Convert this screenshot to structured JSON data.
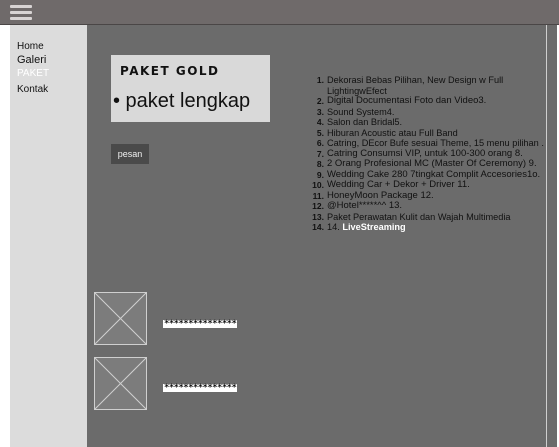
{
  "nav": {
    "items": [
      {
        "label": "Home"
      },
      {
        "label": "Galeri"
      },
      {
        "label": "PAKET"
      },
      {
        "label": "Kontak"
      }
    ],
    "active": "PAKET"
  },
  "package": {
    "title": "PAKET GOLD",
    "bullet": "• paket lengkap",
    "order_button": "pesan"
  },
  "features": [
    {
      "num": "1.",
      "text": "Dekorasi Bebas Pilihan, New Design w Full LightingwEfect"
    },
    {
      "num": "2.",
      "text": " Digital Documentasi Foto dan Video3."
    },
    {
      "num": "3.",
      "text": "Sound System4."
    },
    {
      "num": "4.",
      "text": "Salon dan Bridal5."
    },
    {
      "num": "5.",
      "text": "Hiburan Acoustic atau Full Band"
    },
    {
      "num": "6.",
      "text": "Catring, DEcor Bufe sesuai Theme, 15 menu pilihan ."
    },
    {
      "num": "7.",
      "text": "Catring Consumsi VIP, untuk 100-300 orang 8."
    },
    {
      "num": "8.",
      "text": "2 Orang Profesional MC (Master Of Ceremony) 9."
    },
    {
      "num": "9.",
      "text": "Wedding Cake 280 7tingkat Complit Accesories1o."
    },
    {
      "num": "10.",
      "text": "Wedding Car + Dekor + Driver 11."
    },
    {
      "num": "11.",
      "text": "HoneyMoon Package 12."
    },
    {
      "num": "12.",
      "text": "@Hotel*****^^ 13."
    },
    {
      "num": "13.",
      "text": "Paket Perawatan Kulit dan Wajah Multimedia"
    },
    {
      "num": "14.",
      "text_prefix": " 14. ",
      "text_highlight": "LiveStreaming"
    }
  ],
  "gallery": [
    {
      "caption": "***************"
    },
    {
      "caption": "***************"
    }
  ],
  "icons": {
    "menu": "hamburger-icon",
    "image_placeholder": "image-placeholder-icon"
  },
  "colors": {
    "topbar": "#6f6a6a",
    "sidebar": "#dcdcdc",
    "main": "#6b6b6b",
    "card": "#d9d9d9",
    "button": "#4a4a4a",
    "highlight": "#ffffff"
  }
}
